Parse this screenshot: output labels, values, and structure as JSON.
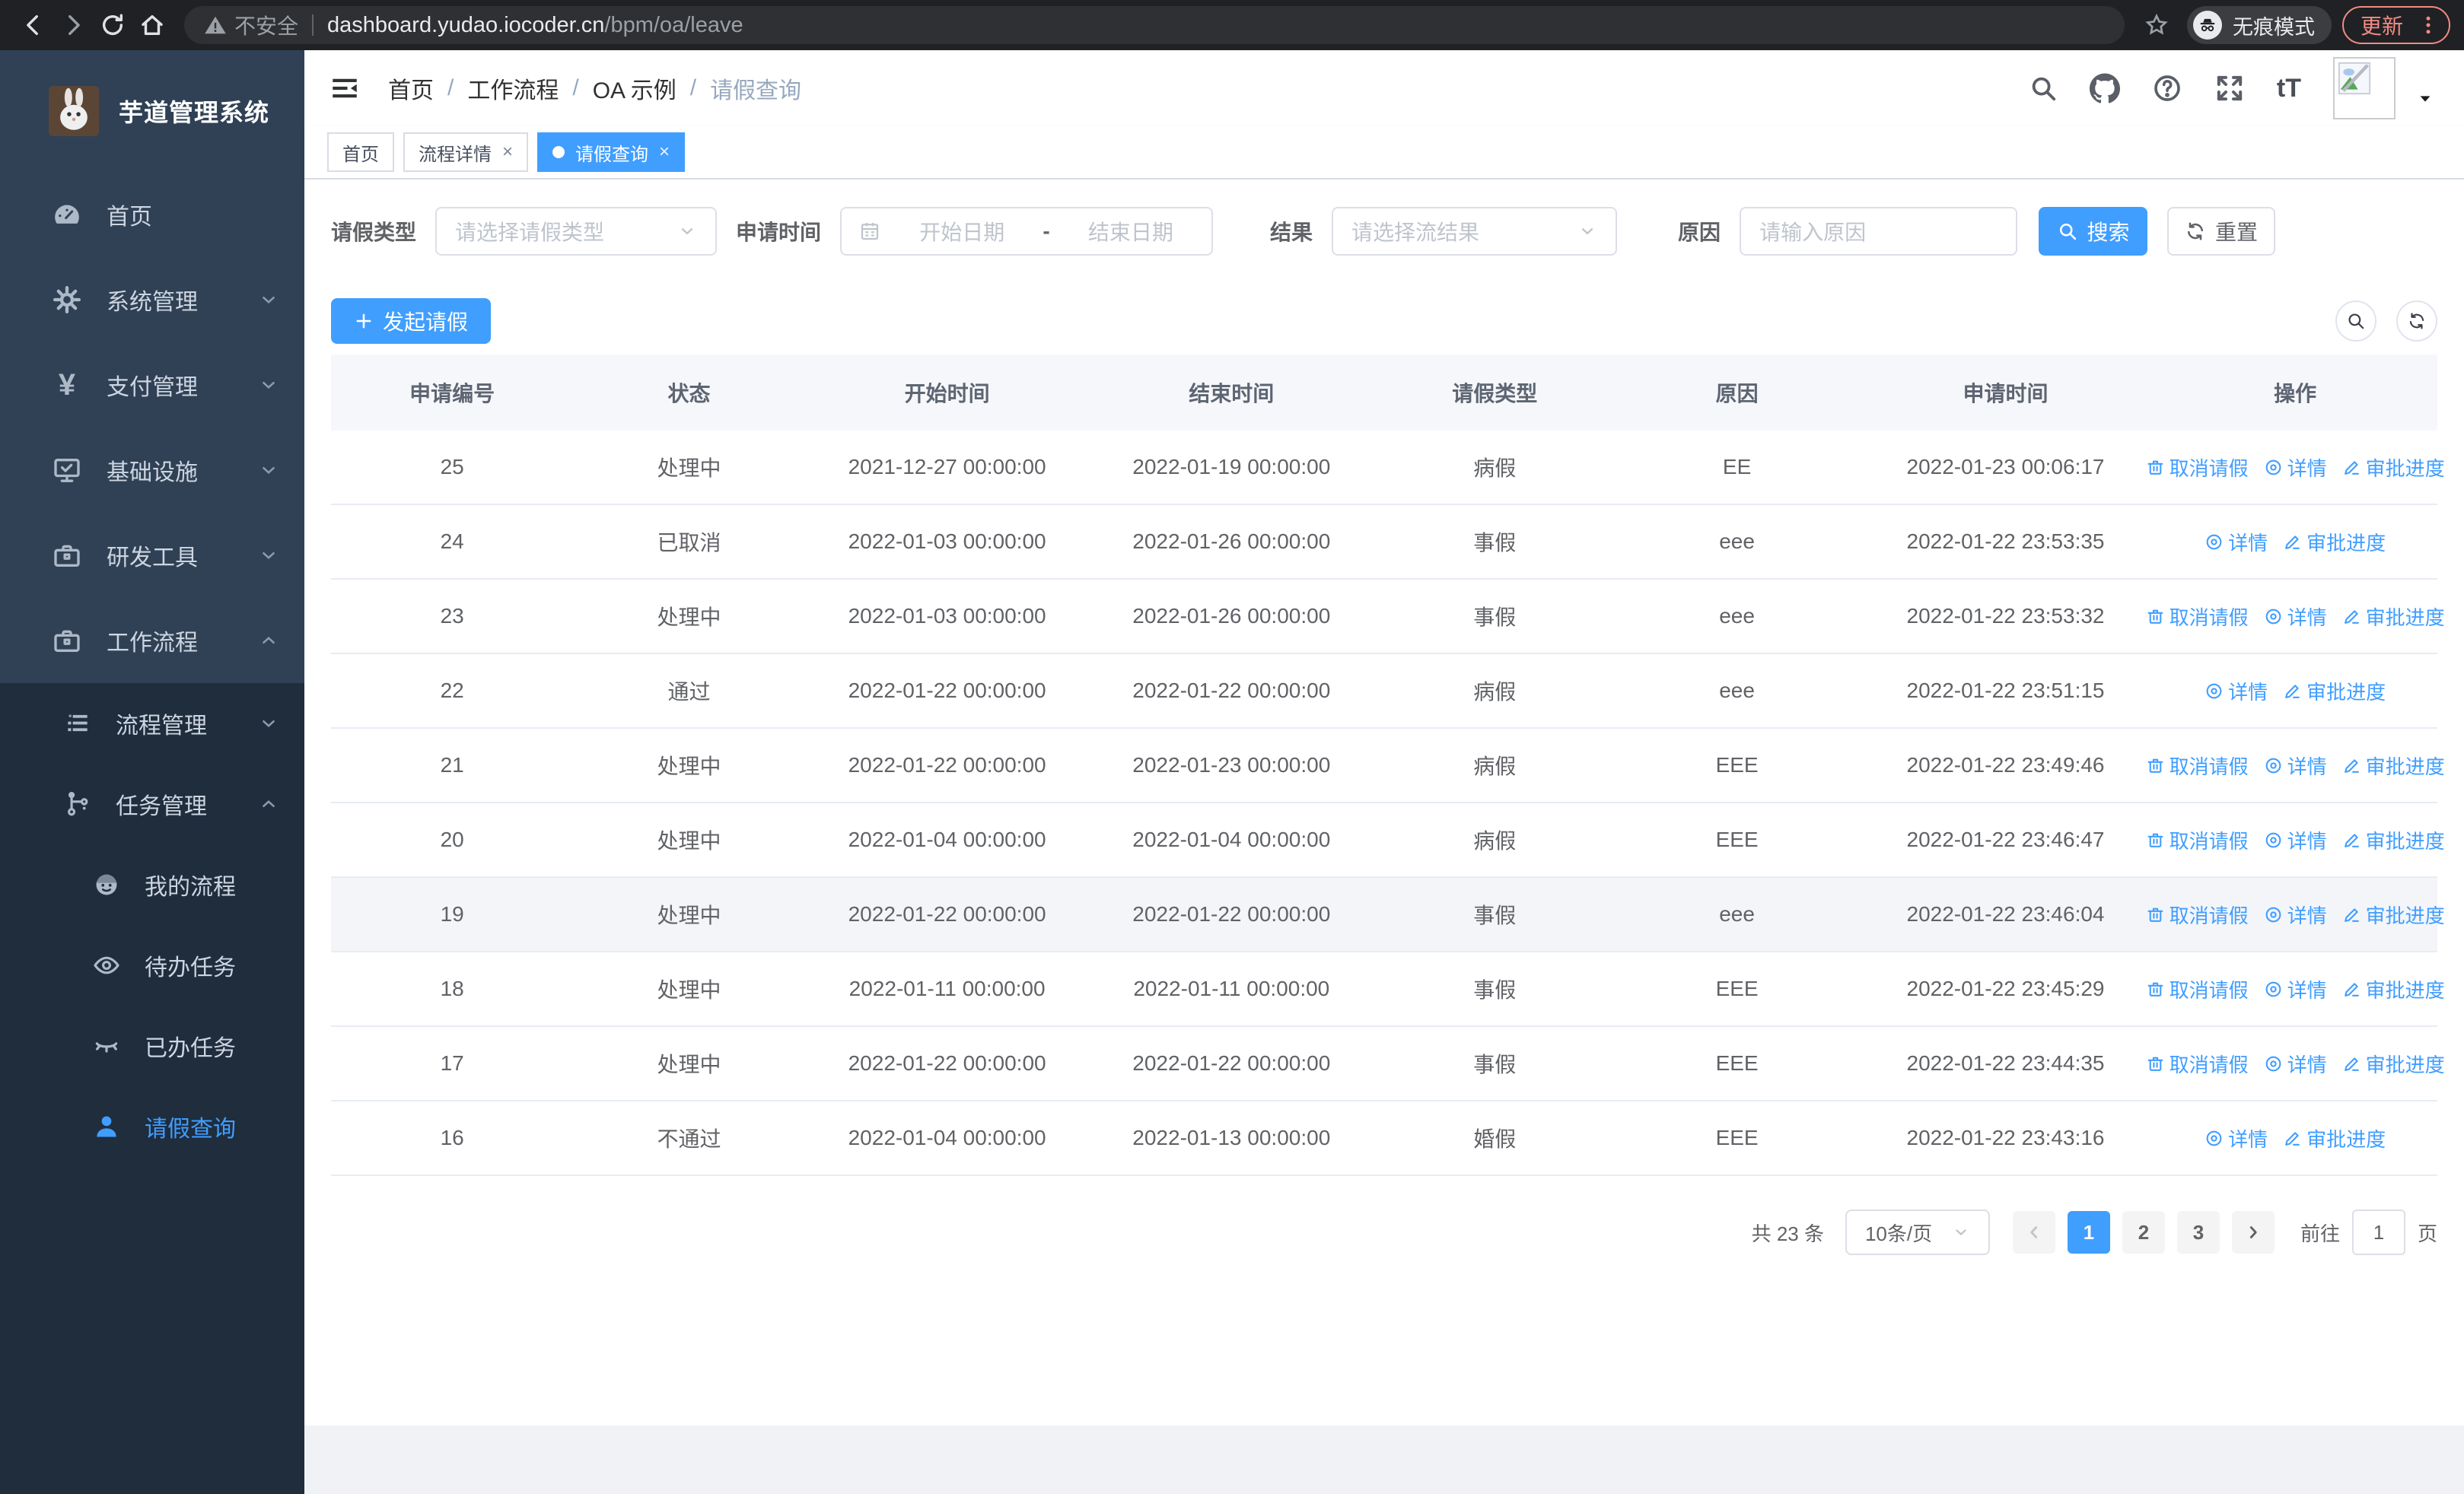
{
  "browser": {
    "security_warning": "不安全",
    "url_domain": "dashboard.yudao.iocoder.cn",
    "url_path": "/bpm/oa/leave",
    "incognito_label": "无痕模式",
    "update_label": "更新"
  },
  "sidebar": {
    "logo_title": "芋道管理系统",
    "items": [
      {
        "label": "首页"
      },
      {
        "label": "系统管理"
      },
      {
        "label": "支付管理"
      },
      {
        "label": "基础设施"
      },
      {
        "label": "研发工具"
      },
      {
        "label": "工作流程"
      }
    ],
    "submenu": [
      {
        "label": "流程管理"
      },
      {
        "label": "任务管理"
      },
      {
        "label": "我的流程"
      },
      {
        "label": "待办任务"
      },
      {
        "label": "已办任务"
      },
      {
        "label": "请假查询"
      }
    ]
  },
  "breadcrumb": {
    "items": [
      "首页",
      "工作流程",
      "OA 示例",
      "请假查询"
    ]
  },
  "tabs": [
    {
      "label": "首页",
      "closable": false,
      "active": false
    },
    {
      "label": "流程详情",
      "closable": true,
      "active": false
    },
    {
      "label": "请假查询",
      "closable": true,
      "active": true
    }
  ],
  "filters": {
    "leave_type_label": "请假类型",
    "leave_type_placeholder": "请选择请假类型",
    "apply_time_label": "申请时间",
    "start_date_placeholder": "开始日期",
    "range_separator": "-",
    "end_date_placeholder": "结束日期",
    "result_label": "结果",
    "result_placeholder": "请选择流结果",
    "reason_label": "原因",
    "reason_placeholder": "请输入原因",
    "search_label": "搜索",
    "reset_label": "重置"
  },
  "toolbar": {
    "create_label": "发起请假"
  },
  "table": {
    "columns": [
      "申请编号",
      "状态",
      "开始时间",
      "结束时间",
      "请假类型",
      "原因",
      "申请时间",
      "操作"
    ],
    "action_labels": {
      "cancel": "取消请假",
      "detail": "详情",
      "progress": "审批进度"
    },
    "rows": [
      {
        "id": "25",
        "status": "处理中",
        "start": "2021-12-27 00:00:00",
        "end": "2022-01-19 00:00:00",
        "type": "病假",
        "reason": "EE",
        "applied": "2022-01-23 00:06:17",
        "cancellable": true,
        "highlighted": false
      },
      {
        "id": "24",
        "status": "已取消",
        "start": "2022-01-03 00:00:00",
        "end": "2022-01-26 00:00:00",
        "type": "事假",
        "reason": "eee",
        "applied": "2022-01-22 23:53:35",
        "cancellable": false,
        "highlighted": false
      },
      {
        "id": "23",
        "status": "处理中",
        "start": "2022-01-03 00:00:00",
        "end": "2022-01-26 00:00:00",
        "type": "事假",
        "reason": "eee",
        "applied": "2022-01-22 23:53:32",
        "cancellable": true,
        "highlighted": false
      },
      {
        "id": "22",
        "status": "通过",
        "start": "2022-01-22 00:00:00",
        "end": "2022-01-22 00:00:00",
        "type": "病假",
        "reason": "eee",
        "applied": "2022-01-22 23:51:15",
        "cancellable": false,
        "highlighted": false
      },
      {
        "id": "21",
        "status": "处理中",
        "start": "2022-01-22 00:00:00",
        "end": "2022-01-23 00:00:00",
        "type": "病假",
        "reason": "EEE",
        "applied": "2022-01-22 23:49:46",
        "cancellable": true,
        "highlighted": false
      },
      {
        "id": "20",
        "status": "处理中",
        "start": "2022-01-04 00:00:00",
        "end": "2022-01-04 00:00:00",
        "type": "病假",
        "reason": "EEE",
        "applied": "2022-01-22 23:46:47",
        "cancellable": true,
        "highlighted": false
      },
      {
        "id": "19",
        "status": "处理中",
        "start": "2022-01-22 00:00:00",
        "end": "2022-01-22 00:00:00",
        "type": "事假",
        "reason": "eee",
        "applied": "2022-01-22 23:46:04",
        "cancellable": true,
        "highlighted": true
      },
      {
        "id": "18",
        "status": "处理中",
        "start": "2022-01-11 00:00:00",
        "end": "2022-01-11 00:00:00",
        "type": "事假",
        "reason": "EEE",
        "applied": "2022-01-22 23:45:29",
        "cancellable": true,
        "highlighted": false
      },
      {
        "id": "17",
        "status": "处理中",
        "start": "2022-01-22 00:00:00",
        "end": "2022-01-22 00:00:00",
        "type": "事假",
        "reason": "EEE",
        "applied": "2022-01-22 23:44:35",
        "cancellable": true,
        "highlighted": false
      },
      {
        "id": "16",
        "status": "不通过",
        "start": "2022-01-04 00:00:00",
        "end": "2022-01-13 00:00:00",
        "type": "婚假",
        "reason": "EEE",
        "applied": "2022-01-22 23:43:16",
        "cancellable": false,
        "highlighted": false
      }
    ]
  },
  "pagination": {
    "total_label": "共 23 条",
    "page_size": "10条/页",
    "pages": [
      "1",
      "2",
      "3"
    ],
    "active_page": "1",
    "goto_label": "前往",
    "goto_value": "1",
    "page_unit": "页"
  },
  "colors": {
    "primary": "#409eff",
    "sidebar_bg": "#304156",
    "submenu_bg": "#1f2d3d",
    "chrome_accent": "#f28b82"
  }
}
